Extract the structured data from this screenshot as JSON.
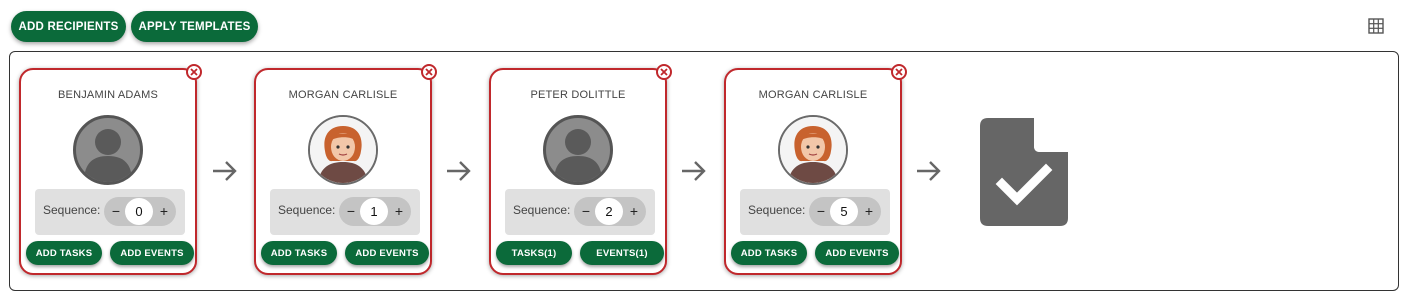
{
  "toolbar": {
    "add_recipients": "ADD RECIPIENTS",
    "apply_templates": "APPLY TEMPLATES",
    "view_icon": "grid-icon"
  },
  "recipients": [
    {
      "name": "BENJAMIN ADAMS",
      "avatar": "generic",
      "sequence_label": "Sequence:",
      "sequence": "0",
      "tasks_label": "ADD TASKS",
      "events_label": "ADD EVENTS"
    },
    {
      "name": "MORGAN CARLISLE",
      "avatar": "photo",
      "sequence_label": "Sequence:",
      "sequence": "1",
      "tasks_label": "ADD TASKS",
      "events_label": "ADD EVENTS"
    },
    {
      "name": "PETER DOLITTLE",
      "avatar": "generic",
      "sequence_label": "Sequence:",
      "sequence": "2",
      "tasks_label": "TASKS(1)",
      "events_label": "EVENTS(1)"
    },
    {
      "name": "MORGAN CARLISLE",
      "avatar": "photo",
      "sequence_label": "Sequence:",
      "sequence": "5",
      "tasks_label": "ADD TASKS",
      "events_label": "ADD EVENTS"
    }
  ],
  "stepper": {
    "minus": "−",
    "plus": "+"
  },
  "end_icon": "document-check-icon",
  "colors": {
    "accent_green": "#0b6a3a",
    "card_border_red": "#c0282c",
    "icon_gray": "#666666"
  }
}
